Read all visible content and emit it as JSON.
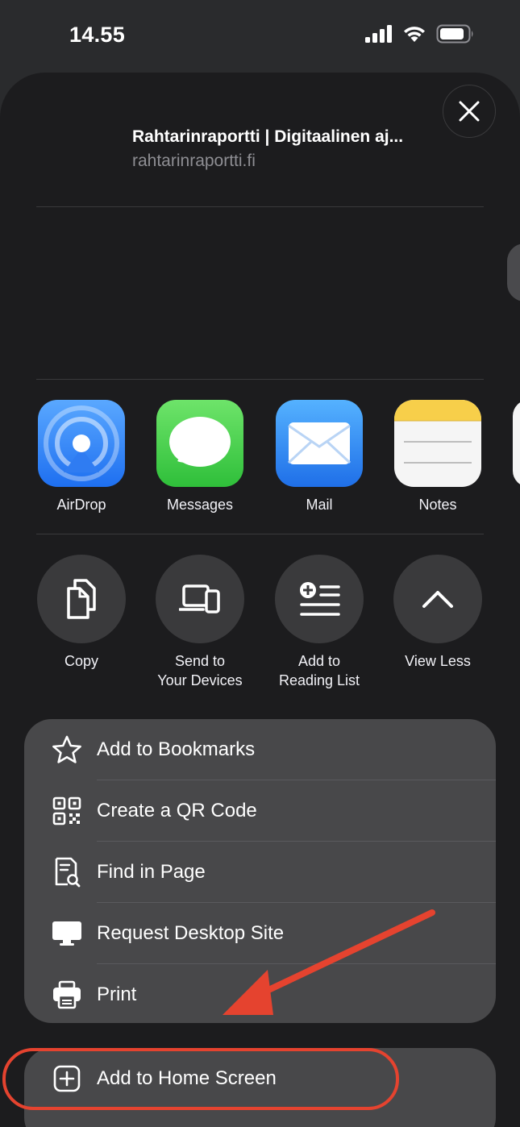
{
  "status": {
    "time": "14.55"
  },
  "header": {
    "title": "Rahtarinraportti | Digitaalinen aj...",
    "url": "rahtarinraportti.fi"
  },
  "apps": [
    {
      "label": "AirDrop",
      "icon": "airdrop-icon"
    },
    {
      "label": "Messages",
      "icon": "messages-icon"
    },
    {
      "label": "Mail",
      "icon": "mail-icon"
    },
    {
      "label": "Notes",
      "icon": "notes-icon"
    }
  ],
  "actions": [
    {
      "label": "Copy",
      "icon": "copy-icon"
    },
    {
      "label": "Send to\nYour Devices",
      "icon": "devices-icon"
    },
    {
      "label": "Add to\nReading List",
      "icon": "reading-list-icon"
    },
    {
      "label": "View Less",
      "icon": "chevron-up-icon"
    }
  ],
  "menu": [
    {
      "label": "Add to Bookmarks",
      "icon": "star-icon"
    },
    {
      "label": "Create a QR Code",
      "icon": "qr-code-icon"
    },
    {
      "label": "Find in Page",
      "icon": "find-in-page-icon"
    },
    {
      "label": "Request Desktop Site",
      "icon": "desktop-icon"
    },
    {
      "label": "Print",
      "icon": "printer-icon"
    }
  ],
  "menu2": [
    {
      "label": "Add to Home Screen",
      "icon": "add-square-icon"
    }
  ],
  "colors": {
    "highlight": "#e5432f",
    "sheet": "#1c1c1e",
    "menu": "#48484a"
  }
}
